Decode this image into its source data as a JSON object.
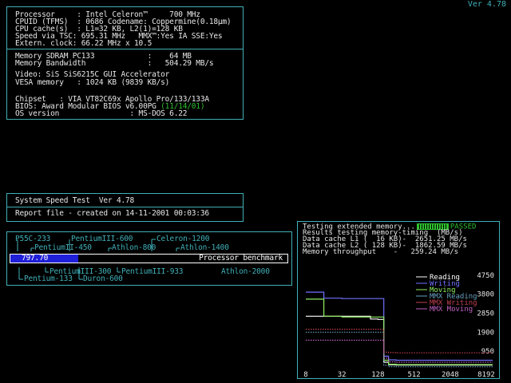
{
  "version_top": "Ver 4.78",
  "info": {
    "processor": "Processor     : Intel Celeron™     700 MHz",
    "cpuid": "CPUID (TFMS)  : 0686 Codename: Coppermine(0.18µm)",
    "cache": "CPU cache(s)  : L1=32 KB, L2(1)=128 KB",
    "speed": "Speed via TSC: 695.31 MHz   MMX™:Yes IA SSE:Yes",
    "clock": "Extern. clock: 66.22 MHz x 10.5",
    "memory": "Memory SDRAM PC133            :    64 MB",
    "bandwidth": "Memory Bandwidth              :   504.29 MB/s",
    "video": "Video: SiS SiS6215C GUI Accelerator",
    "vesa": "VESA memory   : 1024 KB (9839 KB/s)",
    "chipset": "Chipset   : VIA VT82C69x Apollo Pro/133/133A",
    "bios_prefix": "BIOS: Award Modular BIOS v6.00PG ",
    "bios_date": "(11/14/01)",
    "os": "OS version                : MS-DOS 6.22"
  },
  "speedtest": {
    "title": "System Speed Test  Ver 4.78",
    "report": "Report file - created on 14-11-2001 00:03:36"
  },
  "benchmark": {
    "value": "797.70",
    "label": "Processor benchmark",
    "fill_fraction": 0.245,
    "top_labels": [
      {
        "text": "P55C-233"
      },
      {
        "text": "PentiumIII-600"
      },
      {
        "text": "Celeron-1200"
      },
      {
        "text": "PentiumII-450"
      },
      {
        "text": "Athlon-800"
      },
      {
        "text": "Athlon-1400"
      }
    ],
    "bottom_labels": [
      {
        "text": "PentiumIII-300"
      },
      {
        "text": "PentiumIII-933"
      },
      {
        "text": "Athlon-2000"
      },
      {
        "text": "Pentium-133"
      },
      {
        "text": "Duron-600"
      }
    ]
  },
  "memtest": {
    "status_prefix": "Testing extended memory...",
    "status_passed": "PASSED",
    "results_line": "Results testing memory-timing  (MB/s)",
    "l1_line": "Data cache L1 (  16 KB)-  2651.25 MB/s",
    "l2_line": "Data cache L2 ( 128 KB)-  1862.59 MB/s",
    "mem_line": "Memory throughput    -   259.24 MB/s",
    "y_ticks": [
      "4750",
      "3800",
      "2850",
      "1900",
      "950"
    ],
    "x_ticks": [
      "8",
      "32",
      "128",
      "512",
      "2048",
      "8192"
    ],
    "legend": [
      {
        "name": "Reading",
        "color": "#ffffff"
      },
      {
        "name": "Writing",
        "color": "#7070ff"
      },
      {
        "name": "Moving",
        "color": "#90ee60"
      },
      {
        "name": "MMX Reading",
        "color": "#6aa0c0"
      },
      {
        "name": "MMX Writing",
        "color": "#c04050"
      },
      {
        "name": "MMX Moving",
        "color": "#c060c0"
      }
    ]
  },
  "chart_data": {
    "type": "line",
    "x": [
      8,
      16,
      32,
      64,
      96,
      128,
      160,
      192,
      256,
      512,
      1024,
      2048,
      4096,
      8192
    ],
    "ylim": [
      0,
      5500
    ],
    "yticks": [
      950,
      1900,
      2850,
      3800,
      4750
    ],
    "xticks": [
      "8",
      "32",
      "128",
      "512",
      "2048",
      "8192"
    ],
    "series": [
      {
        "name": "Reading",
        "color": "#ffffff",
        "values": [
          2700,
          2700,
          2700,
          2700,
          2560,
          2540,
          400,
          270,
          260,
          259,
          259,
          259,
          259,
          259
        ]
      },
      {
        "name": "Writing",
        "color": "#7070ff",
        "values": [
          3900,
          3600,
          3580,
          3580,
          3580,
          3580,
          700,
          520,
          500,
          500,
          500,
          500,
          500,
          500
        ]
      },
      {
        "name": "Moving",
        "color": "#90ee60",
        "values": [
          3550,
          2700,
          2660,
          2660,
          2660,
          2660,
          500,
          300,
          280,
          280,
          280,
          280,
          280,
          280
        ]
      },
      {
        "name": "MMX Reading",
        "color": "#6aa0c0",
        "values": [
          1900,
          1900,
          1900,
          1900,
          1900,
          1900,
          250,
          180,
          170,
          170,
          170,
          170,
          170,
          170
        ]
      },
      {
        "name": "MMX Writing",
        "color": "#c04050",
        "values": [
          2050,
          2050,
          2050,
          2050,
          2050,
          2050,
          900,
          880,
          870,
          870,
          870,
          870,
          870,
          870
        ]
      },
      {
        "name": "MMX Moving",
        "color": "#c060c0",
        "values": [
          1500,
          1500,
          1500,
          1500,
          1500,
          1500,
          600,
          420,
          400,
          400,
          400,
          400,
          400,
          400
        ]
      }
    ]
  }
}
